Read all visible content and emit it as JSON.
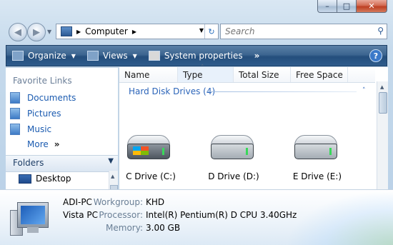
{
  "navigation": {
    "address_path": "Computer",
    "search_placeholder": "Search"
  },
  "toolbar": {
    "organize": "Organize",
    "views": "Views",
    "system_properties": "System properties",
    "more": "»"
  },
  "nav_pane": {
    "favorite_links_title": "Favorite Links",
    "links": [
      "Documents",
      "Pictures",
      "Music"
    ],
    "more": "More",
    "folders_title": "Folders",
    "tree_desktop": "Desktop"
  },
  "content": {
    "columns": [
      "Name",
      "Type",
      "Total Size",
      "Free Space"
    ],
    "group_title": "Hard Disk Drives (4)",
    "drives": [
      "C Drive (C:)",
      "D Drive (D:)",
      "E Drive (E:)"
    ]
  },
  "details": {
    "computer_name": "ADI-PC",
    "os": "Vista PC",
    "workgroup_label": "Workgroup:",
    "workgroup_value": "KHD",
    "processor_label": "Processor:",
    "processor_value": "Intel(R) Pentium(R) D CPU 3.40GHz",
    "memory_label": "Memory:",
    "memory_value": "3.00 GB"
  }
}
